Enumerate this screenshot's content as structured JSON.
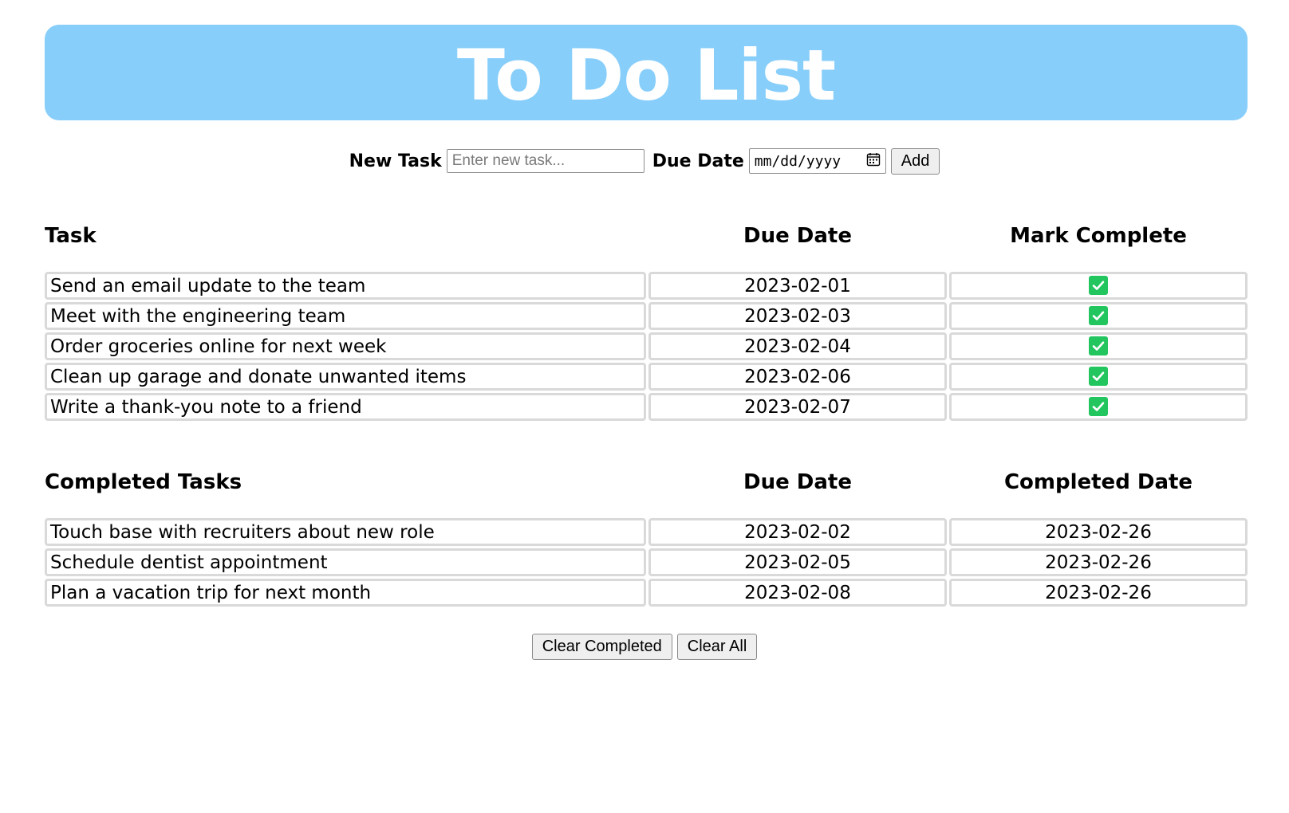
{
  "header": {
    "title": "To Do List"
  },
  "add_form": {
    "task_label": "New Task",
    "task_placeholder": "Enter new task...",
    "task_value": "",
    "date_label": "Due Date",
    "date_placeholder": "mm/dd/yyyy",
    "add_button": "Add"
  },
  "tasks": {
    "headers": [
      "Task",
      "Due Date",
      "Mark Complete"
    ],
    "rows": [
      {
        "task": "Send an email update to the team",
        "due": "2023-02-01",
        "checked": true
      },
      {
        "task": "Meet with the engineering team",
        "due": "2023-02-03",
        "checked": true
      },
      {
        "task": "Order groceries online for next week",
        "due": "2023-02-04",
        "checked": true
      },
      {
        "task": "Clean up garage and donate unwanted items",
        "due": "2023-02-06",
        "checked": true
      },
      {
        "task": "Write a thank-you note to a friend",
        "due": "2023-02-07",
        "checked": true
      }
    ]
  },
  "completed": {
    "headers": [
      "Completed Tasks",
      "Due Date",
      "Completed Date"
    ],
    "rows": [
      {
        "task": "Touch base with recruiters about new role",
        "due": "2023-02-02",
        "completed": "2023-02-26"
      },
      {
        "task": "Schedule dentist appointment",
        "due": "2023-02-05",
        "completed": "2023-02-26"
      },
      {
        "task": "Plan a vacation trip for next month",
        "due": "2023-02-08",
        "completed": "2023-02-26"
      }
    ]
  },
  "actions": {
    "clear_completed": "Clear Completed",
    "clear_all": "Clear All"
  },
  "colors": {
    "banner": "#87cefa",
    "checkbox": "#22c55e",
    "cell_border": "#d9d9d9"
  },
  "icons": {
    "calendar": "calendar-icon",
    "checkbox": "checkmark-icon"
  }
}
